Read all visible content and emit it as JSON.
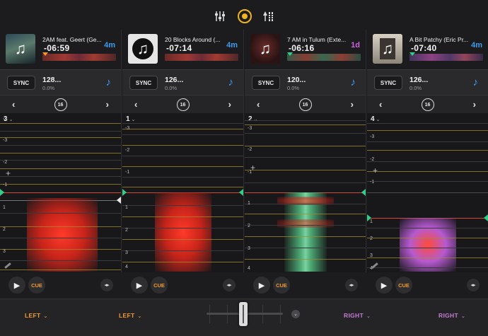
{
  "toolbar": {
    "mixer_icon": "sliders-icon",
    "record_icon": "record-icon",
    "levels_icon": "levels-icon"
  },
  "decks": [
    {
      "title": "2AM feat. Geert (Ge...",
      "time": "-06:59",
      "remain": "4m",
      "sync_label": "SYNC",
      "bpm": "128...",
      "pitch": "0.0%",
      "loop_size": "16",
      "deck_number": "3",
      "bar_labels_top": [
        "-3",
        "-3",
        "-2",
        "-1"
      ],
      "bar_labels_bottom": [
        "1",
        "2",
        "3"
      ],
      "cue_label": "CUE",
      "route": "LEFT"
    },
    {
      "title": "20 Blocks Around (...",
      "time": "-07:14",
      "remain": "4m",
      "sync_label": "SYNC",
      "bpm": "126...",
      "pitch": "0.0%",
      "loop_size": "16",
      "deck_number": "1",
      "bar_labels_top": [
        "-3",
        "-2",
        "-1"
      ],
      "bar_labels_bottom": [
        "1",
        "2",
        "3",
        "4"
      ],
      "cue_label": "CUE",
      "route": "LEFT"
    },
    {
      "title": "7 AM in Tulum (Exte...",
      "time": "-06:16",
      "remain": "1d",
      "sync_label": "SYNC",
      "bpm": "120...",
      "pitch": "0.0%",
      "loop_size": "16",
      "deck_number": "2",
      "bar_labels_top": [
        "-3",
        "-2",
        "-1"
      ],
      "bar_labels_bottom": [
        "1",
        "2",
        "3",
        "4"
      ],
      "cue_label": "CUE",
      "route": "RIGHT"
    },
    {
      "title": "A Bit Patchy (Eric Pr...",
      "time": "-07:40",
      "remain": "4m",
      "sync_label": "SYNC",
      "bpm": "126...",
      "pitch": "0.0%",
      "loop_size": "16",
      "deck_number": "4",
      "bar_labels_top": [
        "-3",
        "-2",
        "-1"
      ],
      "bar_labels_bottom": [
        "1",
        "2",
        "3",
        "4"
      ],
      "cue_label": "CUE",
      "route": "RIGHT"
    }
  ],
  "colors": {
    "accent_orange": "#f39a2c",
    "key_blue": "#3b9cf0",
    "pink": "#d160e3",
    "route_right": "#c77ad6",
    "waveform_red": "#e8301f",
    "marker_green": "#2fd08a"
  },
  "crossfader": {
    "position": 0.5
  }
}
